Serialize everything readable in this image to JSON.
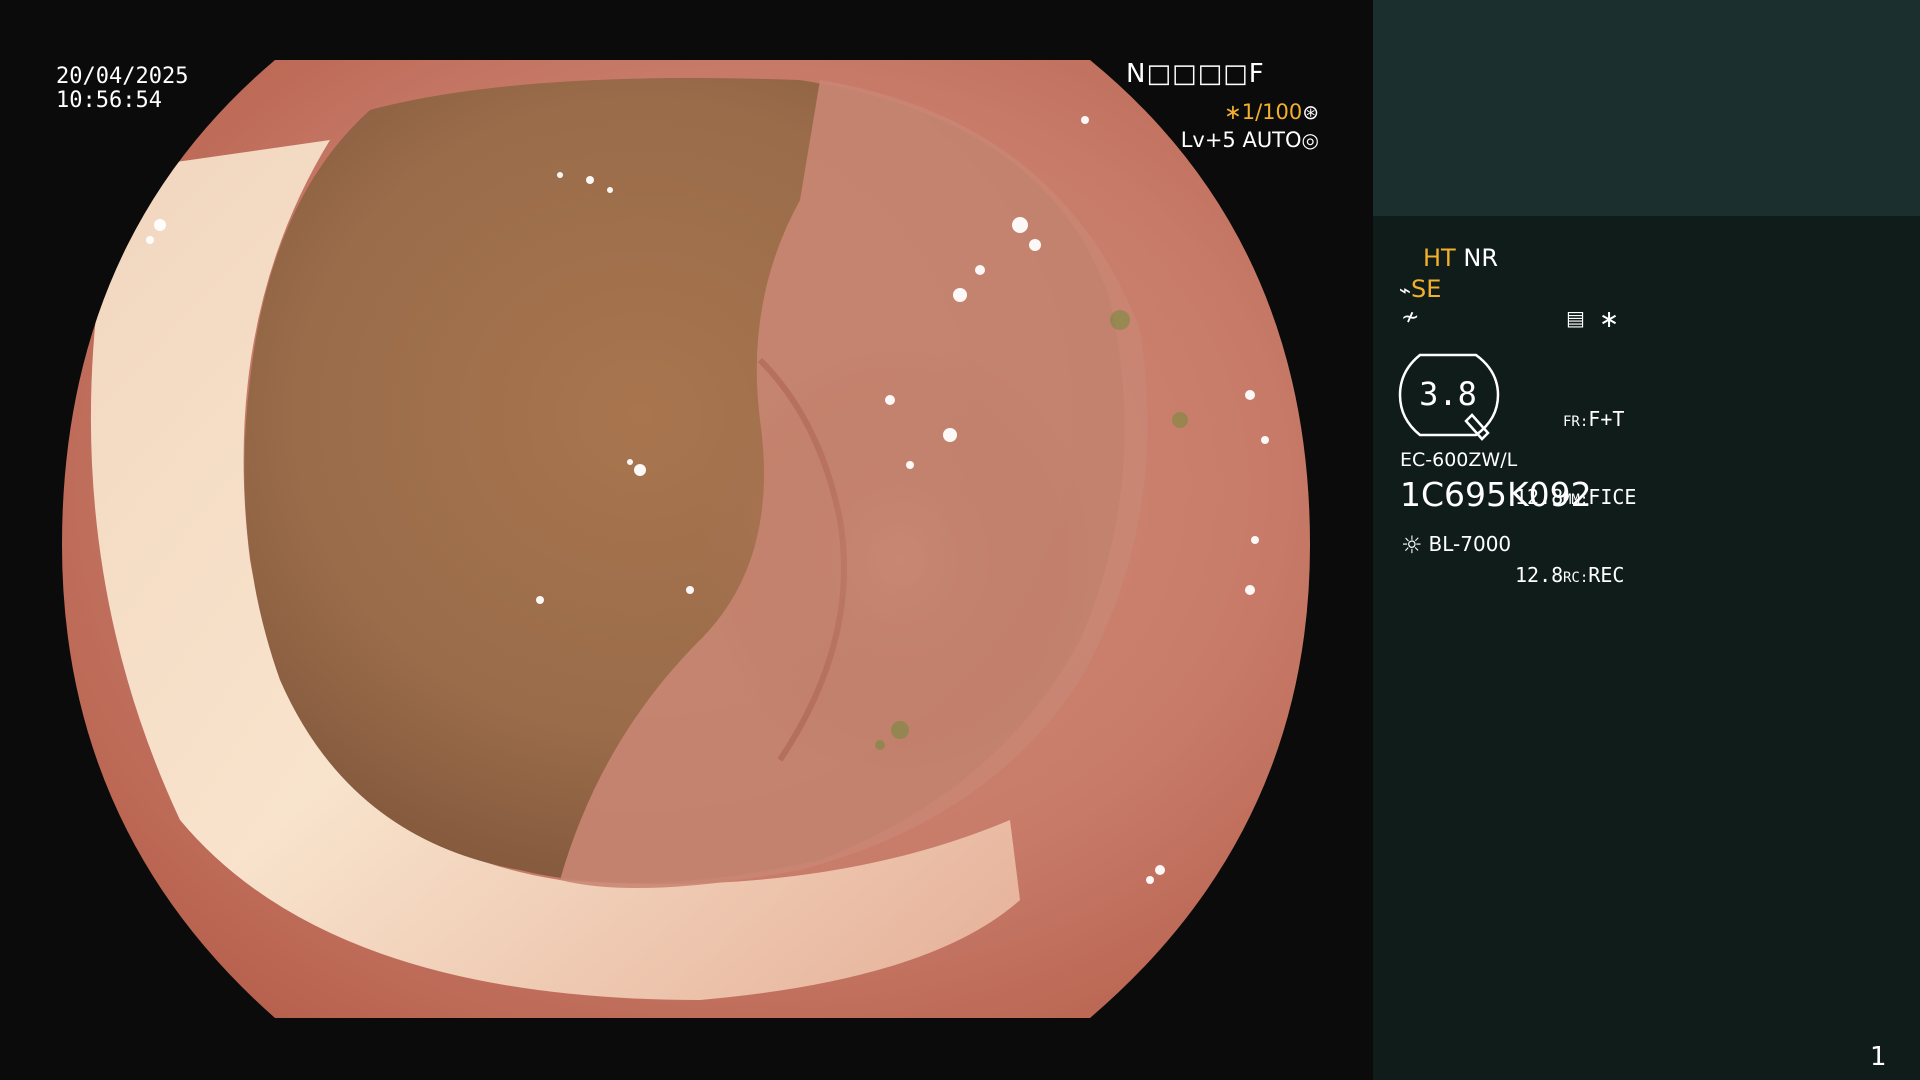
{
  "overlay": {
    "date": "20/04/2025",
    "time": "10:56:54",
    "patient_code": "N□□□□F",
    "shutter": "∗1/100",
    "shutter_icon": "⊛",
    "level": "Lv+5 AUTO",
    "level_icon": "◎"
  },
  "sidebar": {
    "ht": "HT",
    "nr": "NR",
    "se": "SE",
    "se_icon": "⌁",
    "enhance_icon": "≁",
    "menu_icon": "▤",
    "asterisk": "∗",
    "zoom_value": "3.8",
    "stats": [
      {
        "num": "",
        "key": "FR:",
        "val": "F+T"
      },
      {
        "num": "12.8",
        "key": "MM:",
        "val": "FICE"
      },
      {
        "num": "12.8",
        "key": "RC:",
        "val": "REC"
      }
    ],
    "scope_model": "EC-600ZW/L",
    "scope_serial": "1C695K092",
    "light_icon": "☼",
    "light_source": "BL-7000",
    "page_number": "1"
  },
  "colors": {
    "accent_yellow": "#f2b02c",
    "sidebar_bg": "#0f1c1a",
    "sidebar_top_bg": "#1b302e"
  }
}
